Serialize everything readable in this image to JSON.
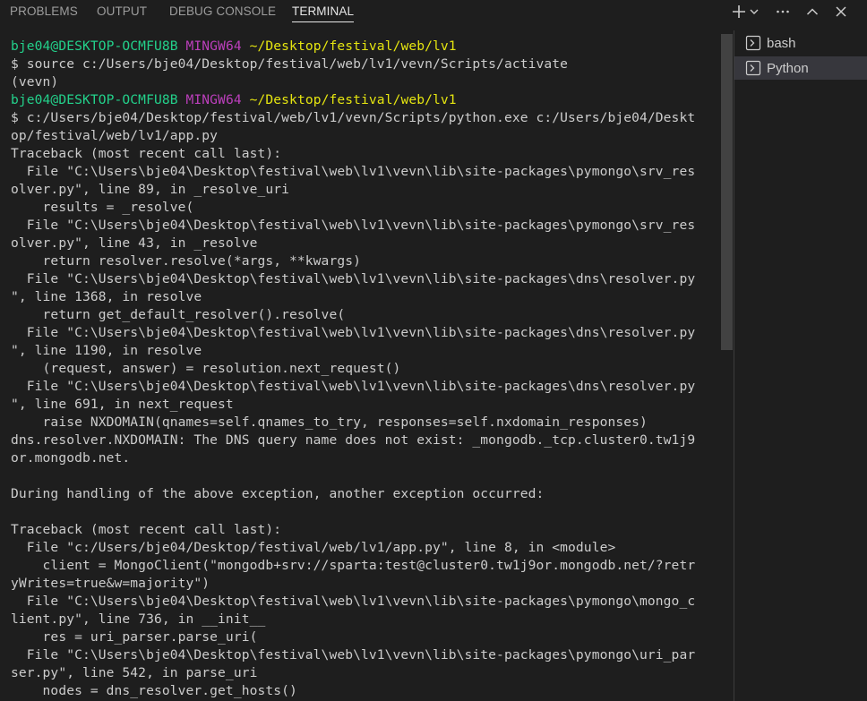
{
  "tabs": {
    "problems": "PROBLEMS",
    "output": "OUTPUT",
    "debug_console": "DEBUG CONSOLE",
    "terminal": "TERMINAL"
  },
  "toolbar": {
    "add_icon": "plus-icon",
    "dropdown_icon": "chevron-down-icon",
    "more_icon": "ellipsis-icon",
    "maximize_icon": "chevron-up-icon",
    "close_icon": "close-icon"
  },
  "terminal_sessions": [
    {
      "label": "bash",
      "icon": "terminal-icon"
    },
    {
      "label": "Python",
      "icon": "terminal-icon"
    }
  ],
  "colors": {
    "background": "#1e1e1e",
    "text": "#cccccc",
    "prompt_user": "#23d18b",
    "prompt_ming": "#bc3fbc",
    "prompt_path": "#e5e510"
  },
  "terminal": {
    "prompt1": {
      "user": "bje04@DESKTOP-OCMFU8B",
      "env": "MINGW64",
      "path": "~/Desktop/festival/web/lv1"
    },
    "cmd1": "$ source c:/Users/bje04/Desktop/festival/web/lv1/vevn/Scripts/activate",
    "venv1": "(vevn)",
    "prompt2": {
      "user": "bje04@DESKTOP-OCMFU8B",
      "env": "MINGW64",
      "path": "~/Desktop/festival/web/lv1"
    },
    "output_lines": [
      "$ c:/Users/bje04/Desktop/festival/web/lv1/vevn/Scripts/python.exe c:/Users/bje04/Deskt",
      "op/festival/web/lv1/app.py",
      "Traceback (most recent call last):",
      "  File \"C:\\Users\\bje04\\Desktop\\festival\\web\\lv1\\vevn\\lib\\site-packages\\pymongo\\srv_res",
      "olver.py\", line 89, in _resolve_uri",
      "    results = _resolve(",
      "  File \"C:\\Users\\bje04\\Desktop\\festival\\web\\lv1\\vevn\\lib\\site-packages\\pymongo\\srv_res",
      "olver.py\", line 43, in _resolve",
      "    return resolver.resolve(*args, **kwargs)",
      "  File \"C:\\Users\\bje04\\Desktop\\festival\\web\\lv1\\vevn\\lib\\site-packages\\dns\\resolver.py",
      "\", line 1368, in resolve",
      "    return get_default_resolver().resolve(",
      "  File \"C:\\Users\\bje04\\Desktop\\festival\\web\\lv1\\vevn\\lib\\site-packages\\dns\\resolver.py",
      "\", line 1190, in resolve",
      "    (request, answer) = resolution.next_request()",
      "  File \"C:\\Users\\bje04\\Desktop\\festival\\web\\lv1\\vevn\\lib\\site-packages\\dns\\resolver.py",
      "\", line 691, in next_request",
      "    raise NXDOMAIN(qnames=self.qnames_to_try, responses=self.nxdomain_responses)",
      "dns.resolver.NXDOMAIN: The DNS query name does not exist: _mongodb._tcp.cluster0.tw1j9",
      "or.mongodb.net.",
      "",
      "During handling of the above exception, another exception occurred:",
      "",
      "Traceback (most recent call last):",
      "  File \"c:/Users/bje04/Desktop/festival/web/lv1/app.py\", line 8, in <module>",
      "    client = MongoClient(\"mongodb+srv://sparta:test@cluster0.tw1j9or.mongodb.net/?retr",
      "yWrites=true&w=majority\")",
      "  File \"C:\\Users\\bje04\\Desktop\\festival\\web\\lv1\\vevn\\lib\\site-packages\\pymongo\\mongo_c",
      "lient.py\", line 736, in __init__",
      "    res = uri_parser.parse_uri(",
      "  File \"C:\\Users\\bje04\\Desktop\\festival\\web\\lv1\\vevn\\lib\\site-packages\\pymongo\\uri_par",
      "ser.py\", line 542, in parse_uri",
      "    nodes = dns_resolver.get_hosts()"
    ]
  }
}
